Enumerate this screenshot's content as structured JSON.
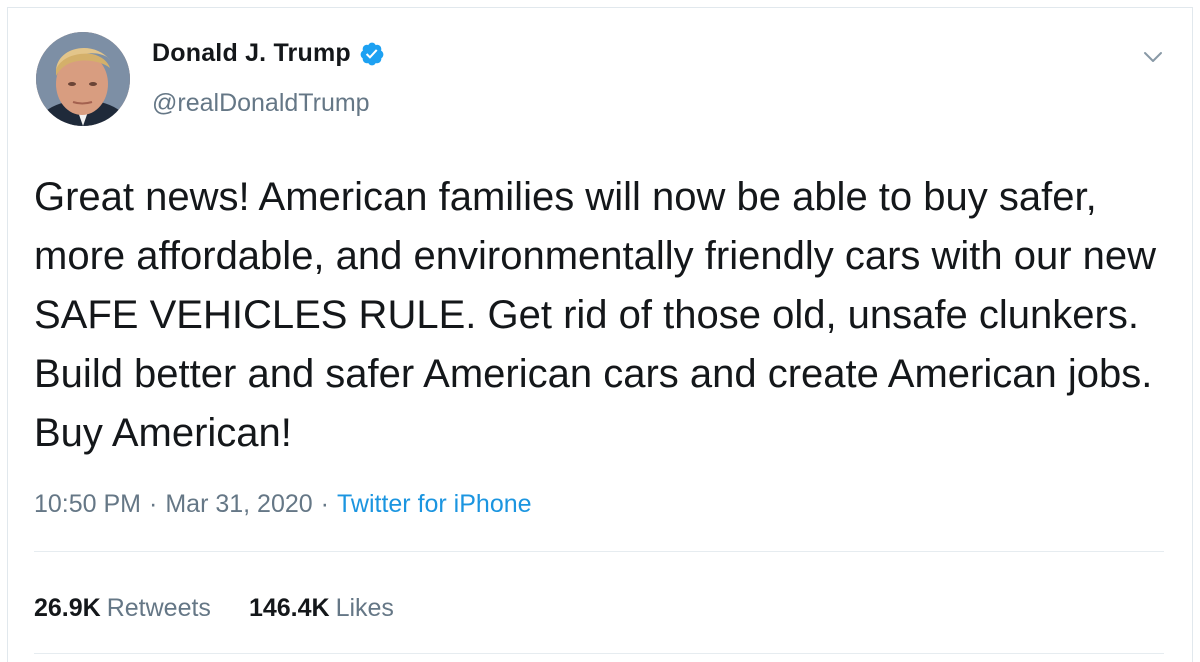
{
  "user": {
    "display_name": "Donald J. Trump",
    "handle": "@realDonaldTrump",
    "verified": true,
    "avatar_icon": "profile-photo"
  },
  "tweet": {
    "text": "Great news! American families will now be able to buy safer, more affordable, and environmentally friendly cars with our new SAFE VEHICLES RULE. Get rid of those old, unsafe clunkers. Build better and safer American cars and create American jobs. Buy American!",
    "time": "10:50 PM",
    "separator": "·",
    "date": "Mar 31, 2020",
    "source": "Twitter for iPhone"
  },
  "stats": {
    "retweets_count": "26.9K",
    "retweets_label": "Retweets",
    "likes_count": "146.4K",
    "likes_label": "Likes"
  },
  "icons": {
    "verified": "verified-badge-icon",
    "menu": "chevron-down-icon"
  },
  "colors": {
    "verified_blue": "#1da1f2",
    "link_blue": "#1b95e0",
    "secondary_text": "#657786",
    "primary_text": "#14171a",
    "divider": "#e6ecf0"
  }
}
